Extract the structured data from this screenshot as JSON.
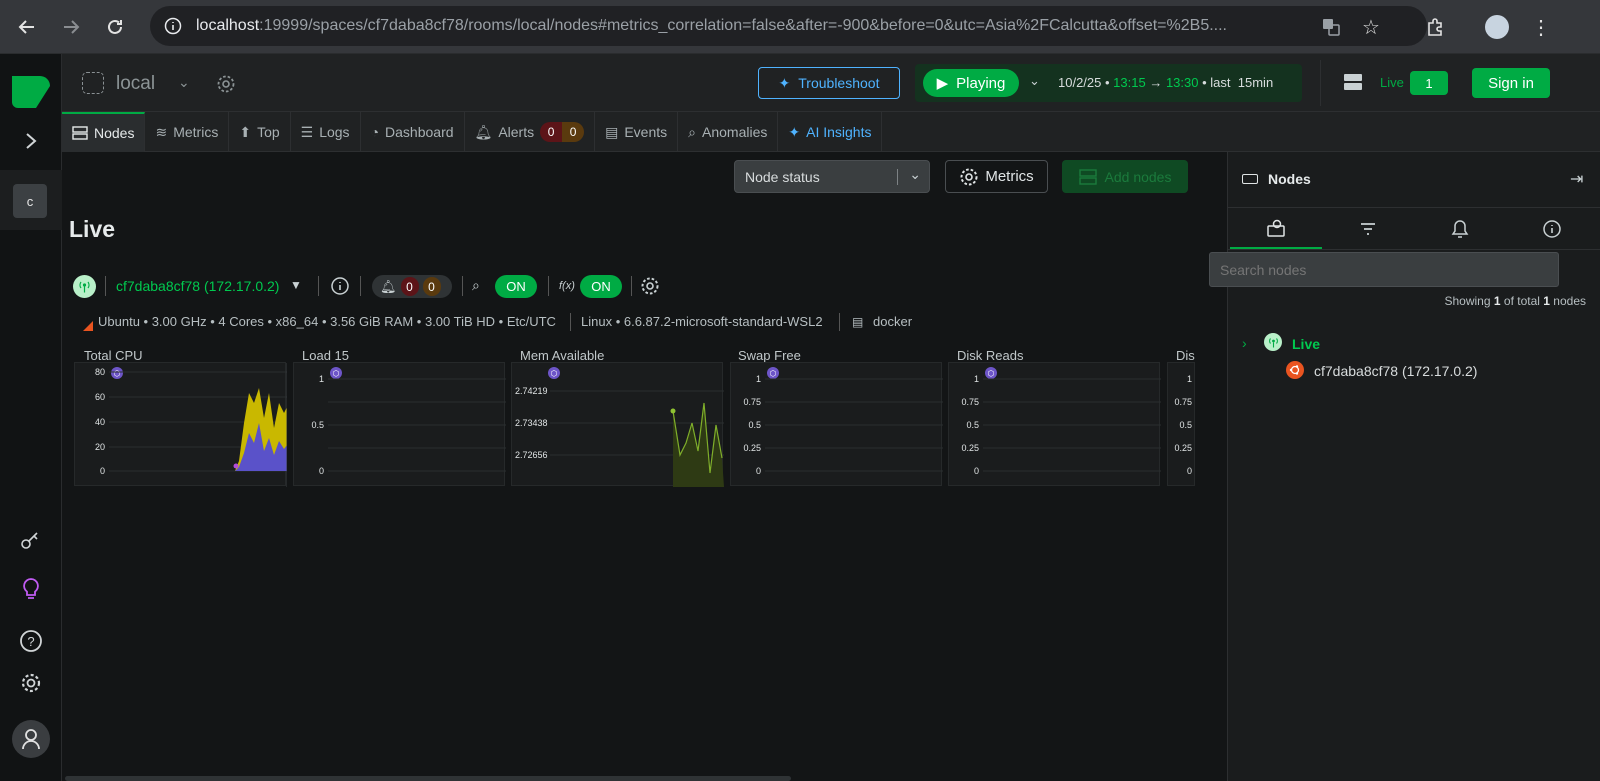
{
  "browser": {
    "url_host": "localhost",
    "url_path": ":19999/spaces/cf7daba8cf78/rooms/local/nodes#metrics_correlation=false&after=-900&before=0&utc=Asia%2FCalcutta&offset=%2B5...."
  },
  "rail": {
    "space_letter": "c"
  },
  "header": {
    "room_name": "local",
    "troubleshoot_label": "Troubleshoot",
    "playing_label": "Playing",
    "date": "10/2/25",
    "time_from": "13:15",
    "arrow": "→",
    "time_to": "13:30",
    "last_label": "• last",
    "duration": "15min",
    "live_label": "Live",
    "live_count": "1",
    "signin_label": "Sign in"
  },
  "tabs": [
    {
      "label": "Nodes"
    },
    {
      "label": "Metrics"
    },
    {
      "label": "Top"
    },
    {
      "label": "Logs"
    },
    {
      "label": "Dashboard"
    },
    {
      "label": "Alerts"
    },
    {
      "label": "Events"
    },
    {
      "label": "Anomalies"
    },
    {
      "label": "AI Insights"
    }
  ],
  "alerts_counts": {
    "critical": "0",
    "warning": "0"
  },
  "toolbar": {
    "node_status": "Node status",
    "metrics_label": "Metrics",
    "add_nodes_label": "Add nodes"
  },
  "section_title": "Live",
  "node": {
    "name": "cf7daba8cf78 (172.17.0.2)",
    "alerts_critical": "0",
    "alerts_warning": "0",
    "toggle1": "ON",
    "fx_label": "f(x)",
    "toggle2": "ON",
    "info": "Ubuntu • 3.00 GHz • 4 Cores • x86_64 • 3.56 GiB RAM • 3.00 TiB HD • Etc/UTC",
    "kernel": "Linux • 6.6.87.2-microsoft-standard-WSL2",
    "container": "docker"
  },
  "charts": [
    {
      "title": "Total CPU",
      "ticks": [
        "80",
        "60",
        "40",
        "20",
        "0"
      ]
    },
    {
      "title": "Load 15",
      "ticks": [
        "1",
        "0.5",
        "0"
      ]
    },
    {
      "title": "Mem Available",
      "ticks": [
        "2.74219",
        "2.73438",
        "2.72656"
      ]
    },
    {
      "title": "Swap Free",
      "ticks": [
        "1",
        "0.75",
        "0.5",
        "0.25",
        "0"
      ]
    },
    {
      "title": "Disk Reads",
      "ticks": [
        "1",
        "0.75",
        "0.5",
        "0.25",
        "0"
      ]
    },
    {
      "title": "Dis",
      "ticks": [
        "1",
        "0.75",
        "0.5",
        "0.25",
        "0"
      ]
    }
  ],
  "right_panel": {
    "title": "Nodes",
    "search_placeholder": "Search nodes",
    "showing_prefix": "Showing",
    "showing_count": "1",
    "showing_mid": "of total",
    "showing_total": "1",
    "showing_suffix": "nodes",
    "group_label": "Live",
    "node_name": "cf7daba8cf78 (172.17.0.2)"
  },
  "colors": {
    "accent": "#00ab44",
    "ai": "#4fb3ff",
    "bg": "#131516"
  }
}
